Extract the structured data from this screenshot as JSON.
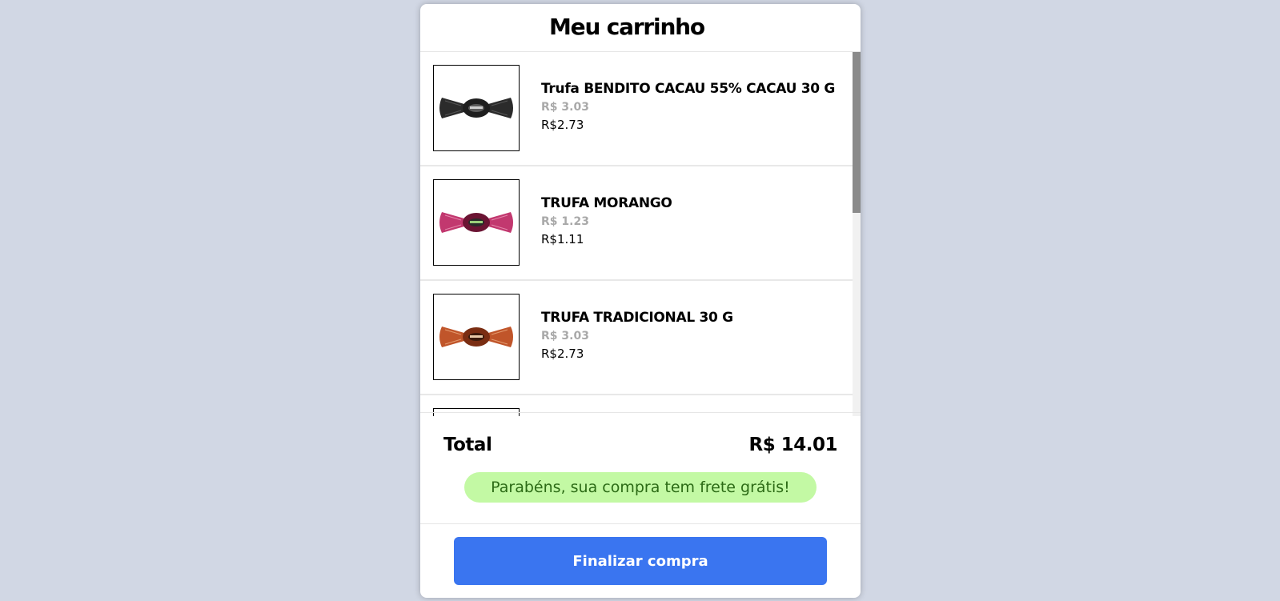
{
  "cart": {
    "title": "Meu carrinho",
    "items": [
      {
        "name": "Trufa BENDITO CACAU 55% CACAU 30 G",
        "old_price": "R$ 3.03",
        "price": "R$2.73",
        "image": "truffle-dark-wrapper-icon",
        "wrapper_color": "#2b2b2b"
      },
      {
        "name": "TRUFA MORANGO",
        "old_price": "R$ 1.23",
        "price": "R$1.11",
        "image": "truffle-pink-wrapper-icon",
        "wrapper_color": "#c2386f"
      },
      {
        "name": "TRUFA TRADICIONAL 30 G",
        "old_price": "R$ 3.03",
        "price": "R$2.73",
        "image": "truffle-orange-wrapper-icon",
        "wrapper_color": "#c0552a"
      }
    ]
  },
  "footer": {
    "total_label": "Total",
    "total_value": "R$ 14.01",
    "shipping_message": "Parabéns, sua compra tem frete grátis!",
    "checkout_label": "Finalizar compra"
  },
  "colors": {
    "background": "#d1d7e4",
    "accent": "#3a75f0",
    "shipping_badge": "#c3f9a4",
    "shipping_text": "#2c6b16"
  }
}
